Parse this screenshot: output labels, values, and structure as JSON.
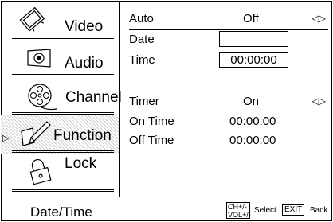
{
  "sidebar": {
    "items": [
      {
        "label": "Video",
        "icon": "tv-icon"
      },
      {
        "label": "Audio",
        "icon": "speaker-icon"
      },
      {
        "label": "Channel",
        "icon": "film-reel-icon"
      },
      {
        "label": "Function",
        "icon": "hand-pencil-icon",
        "selected": true
      },
      {
        "label": "Lock",
        "icon": "padlock-icon"
      }
    ]
  },
  "settings": {
    "auto": {
      "label": "Auto",
      "value": "Off"
    },
    "date": {
      "label": "Date",
      "value": ""
    },
    "time": {
      "label": "Time",
      "value": "00:00:00"
    },
    "timer": {
      "label": "Timer",
      "value": "On"
    },
    "on_time": {
      "label": "On Time",
      "value": "00:00:00"
    },
    "off_time": {
      "label": "Off Time",
      "value": "00:00:00"
    }
  },
  "footer": {
    "title": "Date/Time",
    "ch_key": "CH+/-",
    "vol_key": "VOL+/-",
    "select_label": "Select",
    "exit_key": "EXIT",
    "back_label": "Back"
  }
}
